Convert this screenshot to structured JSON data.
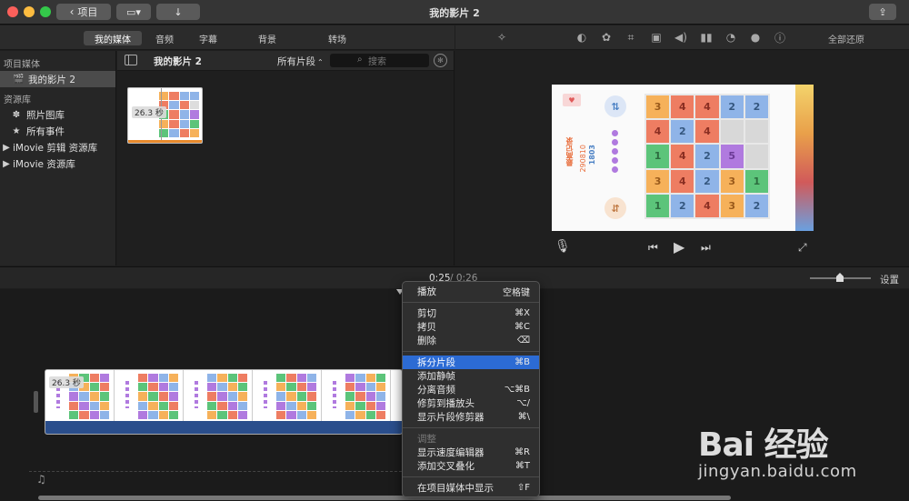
{
  "window": {
    "title": "我的影片 2",
    "back_label": "项目"
  },
  "media_tabs": [
    "我的媒体",
    "音频",
    "字幕",
    "背景",
    "转场"
  ],
  "viewer_tools": {
    "reset_all": "全部还原",
    "icons": [
      "magic-wand-icon",
      "color-balance-icon",
      "color-correction-icon",
      "crop-icon",
      "stabilization-icon",
      "volume-icon",
      "equalizer-icon",
      "speed-icon",
      "filter-icon",
      "info-icon"
    ]
  },
  "sidebar": {
    "project_media_header": "项目媒体",
    "project_item": "我的影片 2",
    "libraries_header": "资源库",
    "library_items": [
      "照片图库",
      "所有事件"
    ],
    "imovie_items": [
      "iMovie 剪辑 资源库",
      "iMovie 资源库"
    ]
  },
  "browser": {
    "title": "我的影片 2",
    "filter": "所有片段",
    "search_placeholder": "搜索",
    "clip_duration": "26.3 秒"
  },
  "video": {
    "record_label": "最高记录",
    "record_value": "290810",
    "score": "1803",
    "board": [
      [
        "3",
        "4",
        "4",
        "2",
        "2"
      ],
      [
        "4",
        "2",
        "4",
        "",
        ""
      ],
      [
        "1",
        "4",
        "2",
        "5",
        ""
      ],
      [
        "3",
        "4",
        "2",
        "3",
        "1"
      ],
      [
        "1",
        "2",
        "4",
        "3",
        "2"
      ]
    ]
  },
  "timeline": {
    "time_current": "0:25",
    "time_total": "/ 0:26",
    "settings": "设置",
    "clip_duration": "26.3 秒"
  },
  "context_menu": {
    "items": [
      {
        "label": "播放",
        "shortcut": "空格键"
      },
      {
        "sep": true
      },
      {
        "label": "剪切",
        "shortcut": "⌘X"
      },
      {
        "label": "拷贝",
        "shortcut": "⌘C"
      },
      {
        "label": "删除",
        "shortcut": "⌫"
      },
      {
        "sep": true
      },
      {
        "label": "拆分片段",
        "shortcut": "⌘B",
        "highlighted": true
      },
      {
        "label": "添加静帧",
        "shortcut": ""
      },
      {
        "label": "分离音频",
        "shortcut": "⌥⌘B"
      },
      {
        "label": "修剪到播放头",
        "shortcut": "⌥/"
      },
      {
        "label": "显示片段修剪器",
        "shortcut": "⌘\\"
      },
      {
        "sep": true
      },
      {
        "label": "调整",
        "shortcut": "",
        "disabled": true
      },
      {
        "label": "显示速度编辑器",
        "shortcut": "⌘R"
      },
      {
        "label": "添加交叉叠化",
        "shortcut": "⌘T"
      },
      {
        "sep": true
      },
      {
        "label": "在项目媒体中显示",
        "shortcut": "⇧F"
      }
    ]
  },
  "watermark": {
    "logo": "Bai 经验",
    "url": "jingyan.baidu.com"
  },
  "colors": {
    "menu_highlight": "#2c6bd4",
    "audio_track": "#2a4e8c",
    "tile_orange": "#f6b15a",
    "tile_red": "#ee7d62",
    "tile_blue": "#8fb4e8",
    "tile_green": "#5cc47a",
    "tile_purple": "#b07adf"
  }
}
